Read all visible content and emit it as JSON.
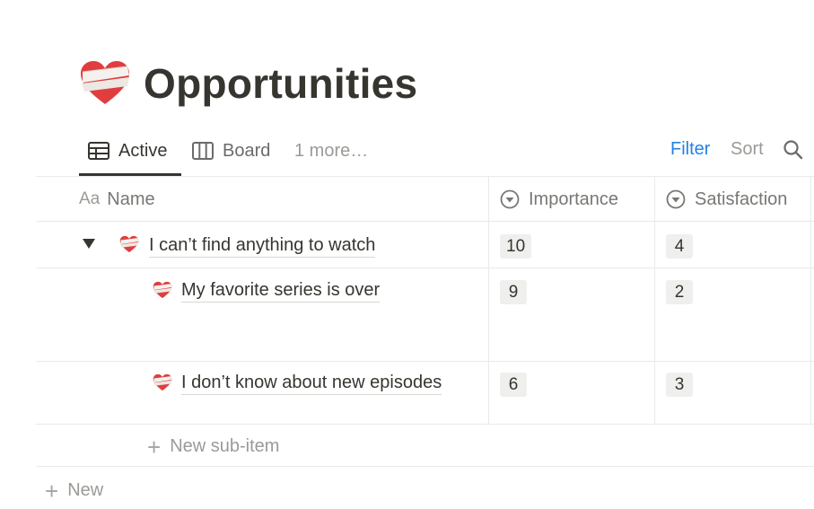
{
  "page": {
    "title": "Opportunities",
    "icon": "bandaged-heart-icon"
  },
  "views": {
    "tabs": [
      {
        "label": "Active",
        "icon": "table-icon",
        "active": true
      },
      {
        "label": "Board",
        "icon": "board-icon",
        "active": false
      }
    ],
    "more_label": "1 more…"
  },
  "toolbar": {
    "filter_label": "Filter",
    "sort_label": "Sort",
    "search_icon": "search-icon"
  },
  "table": {
    "columns": [
      {
        "label": "Name",
        "type_label": "Aa"
      },
      {
        "label": "Importance",
        "icon": "select-icon"
      },
      {
        "label": "Satisfaction",
        "icon": "select-icon"
      }
    ],
    "rows": [
      {
        "title": "I can’t find anything to watch",
        "importance": "10",
        "satisfaction": "4",
        "level": 0,
        "expanded": true
      },
      {
        "title": "My favorite series is over",
        "importance": "9",
        "satisfaction": "2",
        "level": 1
      },
      {
        "title": "I don’t know about new episodes",
        "importance": "6",
        "satisfaction": "3",
        "level": 1
      }
    ],
    "new_sub_item_label": "New sub-item",
    "new_label": "New"
  },
  "colors": {
    "accent": "#2383e2",
    "heart_red": "#e03e3e",
    "text": "#37352f",
    "muted": "#9b9a97"
  }
}
